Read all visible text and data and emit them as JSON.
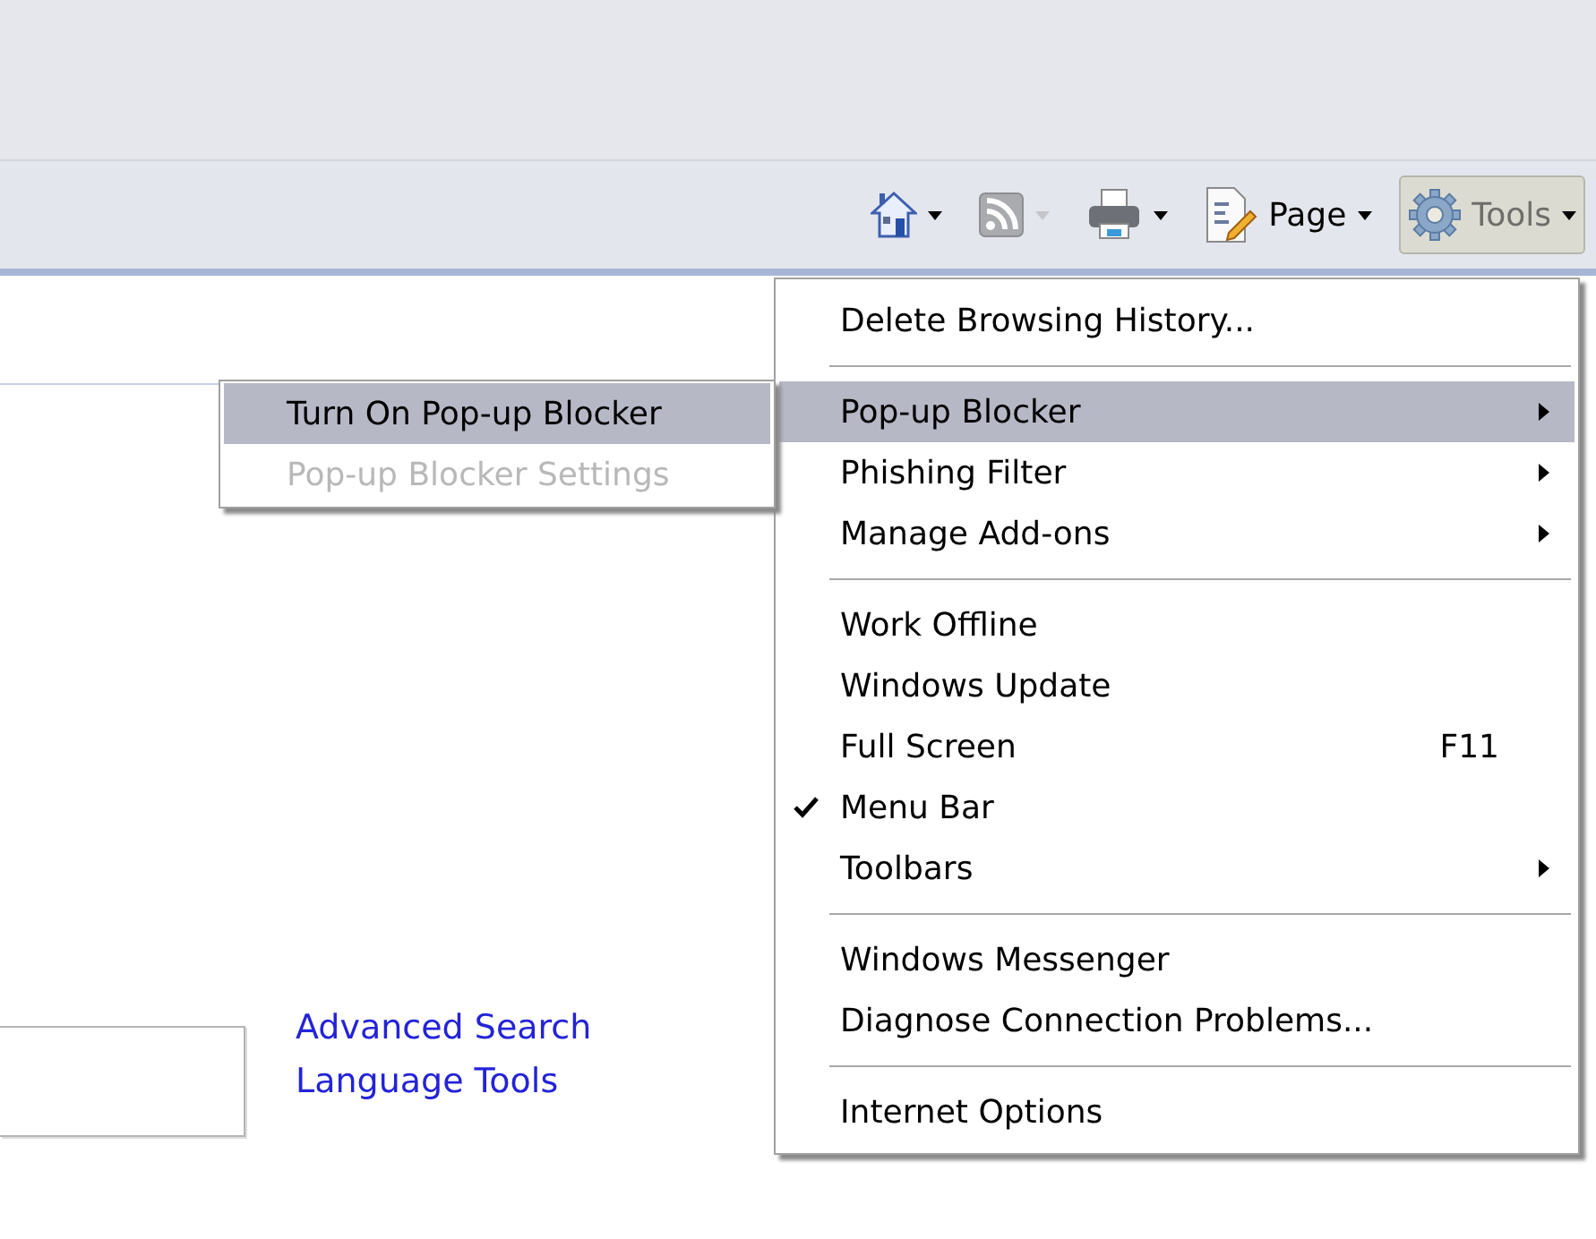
{
  "toolbar": {
    "buttons": [
      {
        "kind": "home",
        "disabled": false,
        "selected": false
      },
      {
        "kind": "feeds",
        "disabled": true,
        "selected": false
      },
      {
        "kind": "print",
        "disabled": false,
        "selected": false
      },
      {
        "kind": "page",
        "label": "Page",
        "disabled": false,
        "selected": false
      },
      {
        "kind": "tools",
        "label": "Tools",
        "disabled": false,
        "selected": true
      }
    ]
  },
  "tools_menu": {
    "items": [
      {
        "kind": "item",
        "label": "Delete Browsing History...",
        "submenu": false,
        "checked": false,
        "selected": false,
        "disabled": false
      },
      {
        "kind": "separator"
      },
      {
        "kind": "item",
        "label": "Pop-up Blocker",
        "submenu": true,
        "checked": false,
        "selected": true,
        "disabled": false
      },
      {
        "kind": "item",
        "label": "Phishing Filter",
        "submenu": true,
        "checked": false,
        "selected": false,
        "disabled": false
      },
      {
        "kind": "item",
        "label": "Manage Add-ons",
        "submenu": true,
        "checked": false,
        "selected": false,
        "disabled": false
      },
      {
        "kind": "separator"
      },
      {
        "kind": "item",
        "label": "Work Offline",
        "submenu": false,
        "checked": false,
        "selected": false,
        "disabled": false
      },
      {
        "kind": "item",
        "label": "Windows Update",
        "submenu": false,
        "checked": false,
        "selected": false,
        "disabled": false
      },
      {
        "kind": "item",
        "label": "Full Screen",
        "shortcut": "F11",
        "submenu": false,
        "checked": false,
        "selected": false,
        "disabled": false
      },
      {
        "kind": "item",
        "label": "Menu Bar",
        "submenu": false,
        "checked": true,
        "selected": false,
        "disabled": false
      },
      {
        "kind": "item",
        "label": "Toolbars",
        "submenu": true,
        "checked": false,
        "selected": false,
        "disabled": false
      },
      {
        "kind": "separator"
      },
      {
        "kind": "item",
        "label": "Windows Messenger",
        "submenu": false,
        "checked": false,
        "selected": false,
        "disabled": false
      },
      {
        "kind": "item",
        "label": "Diagnose Connection Problems...",
        "submenu": false,
        "checked": false,
        "selected": false,
        "disabled": false
      },
      {
        "kind": "separator"
      },
      {
        "kind": "item",
        "label": "Internet Options",
        "submenu": false,
        "checked": false,
        "selected": false,
        "disabled": false
      }
    ]
  },
  "popup_blocker_submenu": {
    "items": [
      {
        "label": "Turn On Pop-up Blocker",
        "selected": true,
        "disabled": false
      },
      {
        "label": "Pop-up Blocker Settings",
        "selected": false,
        "disabled": true
      }
    ]
  },
  "page": {
    "links": [
      "Advanced Search",
      "Language Tools"
    ]
  }
}
